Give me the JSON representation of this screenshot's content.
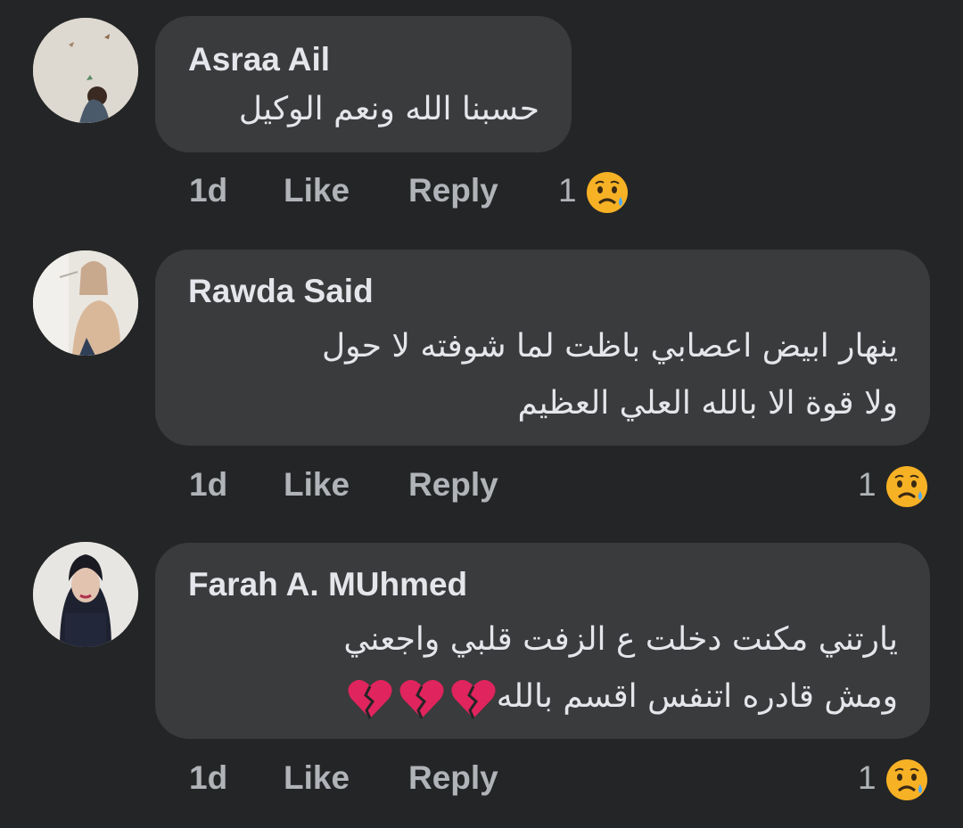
{
  "comments": [
    {
      "author": "Asraa Ail",
      "lines": [
        "حسبنا الله ونعم الوكيل"
      ],
      "time": "1d",
      "like_label": "Like",
      "reply_label": "Reply",
      "reaction_count": "1",
      "reaction_icon": "sad-face-icon"
    },
    {
      "author": "Rawda Said",
      "lines": [
        "ينهار ابيض اعصابي باظت لما شوفته  لا حول",
        "ولا قوة الا بالله العلي العظيم"
      ],
      "time": "1d",
      "like_label": "Like",
      "reply_label": "Reply",
      "reaction_count": "1",
      "reaction_icon": "sad-face-icon"
    },
    {
      "author": "Farah A. MUhmed",
      "lines": [
        "يارتني مكنت دخلت ع الزفت قلبي واجعني",
        "ومش قادره اتنفس اقسم بالله"
      ],
      "trailing_icons": [
        "broken-heart-icon",
        "broken-heart-icon",
        "broken-heart-icon"
      ],
      "time": "1d",
      "like_label": "Like",
      "reply_label": "Reply",
      "reaction_count": "1",
      "reaction_icon": "sad-face-icon"
    }
  ],
  "colors": {
    "background": "#242526",
    "bubble": "#3a3b3c",
    "primary_text": "#e4e6eb",
    "secondary_text": "#b0b3b8",
    "emoji_yellow": "#f7b125",
    "broken_heart": "#e0245e"
  }
}
